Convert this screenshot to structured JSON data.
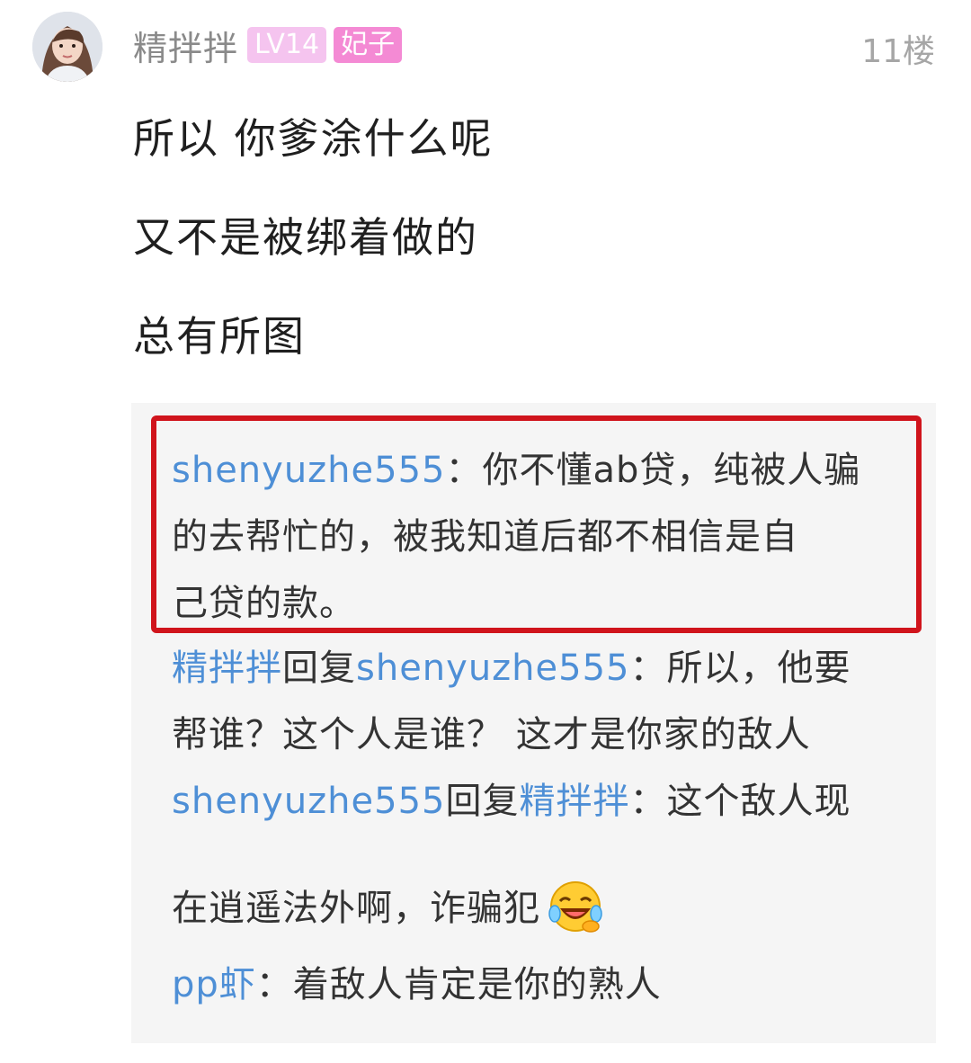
{
  "post": {
    "username": "精拌拌",
    "level_badge": "LV14",
    "title_badge": "妃子",
    "floor": "11楼",
    "lines": [
      "所以 你爹涂什么呢",
      "又不是被绑着做的",
      "总有所图"
    ]
  },
  "replies": [
    {
      "author": "shenyuzhe555",
      "sep": "：",
      "lines": [
        "你不懂ab贷，纯被人骗",
        "的去帮忙的，被我知道后都不相信是自",
        "己贷的款。"
      ]
    },
    {
      "author": "精拌拌",
      "reply_word": "回复",
      "target": "shenyuzhe555",
      "sep": "：",
      "lines": [
        "所以，他要",
        "帮谁？这个人是谁？ 这才是你家的敌人"
      ]
    },
    {
      "author": "shenyuzhe555",
      "reply_word": "回复",
      "target": "精拌拌",
      "sep": "：",
      "lines": [
        "这个敌人现",
        "在逍遥法外啊，诈骗犯"
      ],
      "emoji": "laughing-tears-emoji"
    },
    {
      "author": "pp虾",
      "sep": "：",
      "lines": [
        "着敌人肯定是你的熟人"
      ]
    }
  ],
  "colors": {
    "link_blue": "#4e8fd6",
    "highlight_red": "#d0141c",
    "reply_bg": "#f5f5f5"
  }
}
